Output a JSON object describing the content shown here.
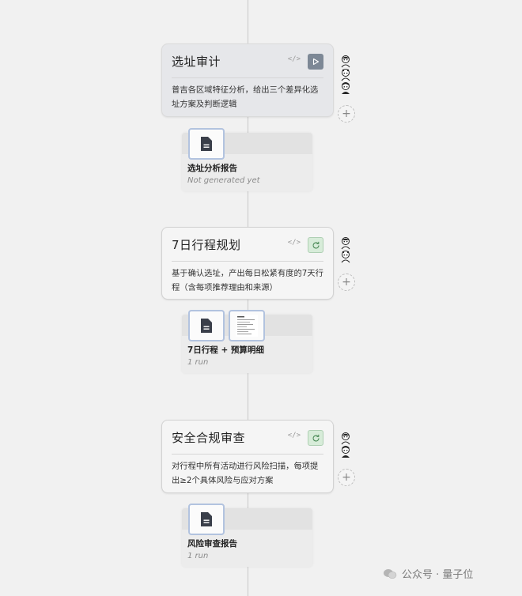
{
  "steps": [
    {
      "title": "选址审计",
      "description": "普吉各区域特征分析，给出三个差异化选址方案及判断逻辑",
      "code_label": "</>",
      "action_icon": "play-icon",
      "output": {
        "name": "选址分析报告",
        "status": "Not generated yet"
      }
    },
    {
      "title": "7日行程规划",
      "description": "基于确认选址，产出每日松紧有度的7天行程（含每项推荐理由和来源）",
      "code_label": "</>",
      "action_icon": "refresh-icon",
      "output": {
        "name": "7日行程 + 预算明细",
        "status": "1 run"
      }
    },
    {
      "title": "安全合规审查",
      "description": "对行程中所有活动进行风险扫描，每项提出≥2个具体风险与应对方案",
      "code_label": "</>",
      "action_icon": "refresh-icon",
      "output": {
        "name": "风险审查报告",
        "status": "1 run"
      }
    }
  ],
  "add_label": "+",
  "watermark": {
    "text": "公众号 · 量子位"
  },
  "colors": {
    "background": "#f1f1f1",
    "run_button": "#7d8896",
    "refresh_button": "#d7ecd9",
    "thumb_border": "#b2c3df"
  }
}
